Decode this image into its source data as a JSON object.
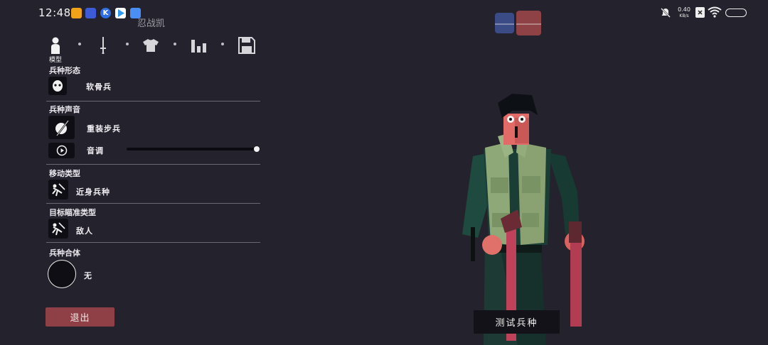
{
  "status_bar": {
    "time": "12:48",
    "net_speed_value": "0.40",
    "net_speed_unit": "KB/s",
    "app_icons": [
      {
        "name": "orange-app-icon",
        "color": "#f0a21b"
      },
      {
        "name": "vivo-app-icon",
        "color": "#3d5bd6"
      },
      {
        "name": "k-app-icon",
        "color": "#2f6fe4"
      },
      {
        "name": "play-store-icon",
        "color": "#2f9bf0"
      },
      {
        "name": "blue-app-icon",
        "color": "#4a8ff5"
      }
    ]
  },
  "unit_name": "忍战凯",
  "tabs": {
    "active_label": "模型",
    "items": [
      "person-icon",
      "sword-icon",
      "shirt-icon",
      "stats-icon",
      "save-icon"
    ]
  },
  "sections": {
    "form": {
      "title": "兵种形态",
      "value": "软骨兵"
    },
    "voice": {
      "title": "兵种声音",
      "value": "重装步兵",
      "pitch_label": "音调",
      "pitch_level": 1.0
    },
    "movement": {
      "title": "移动类型",
      "value": "近身兵种"
    },
    "targeting": {
      "title": "目标瞄准类型",
      "value": "敌人"
    },
    "combine": {
      "title": "兵种合体",
      "value": "无"
    }
  },
  "buttons": {
    "exit": "退出",
    "test_unit": "测试兵种"
  },
  "colors": {
    "background": "#24222c",
    "team_blue": "#3b4b86",
    "team_red": "#8e4245",
    "exit_button": "#8e4046"
  }
}
